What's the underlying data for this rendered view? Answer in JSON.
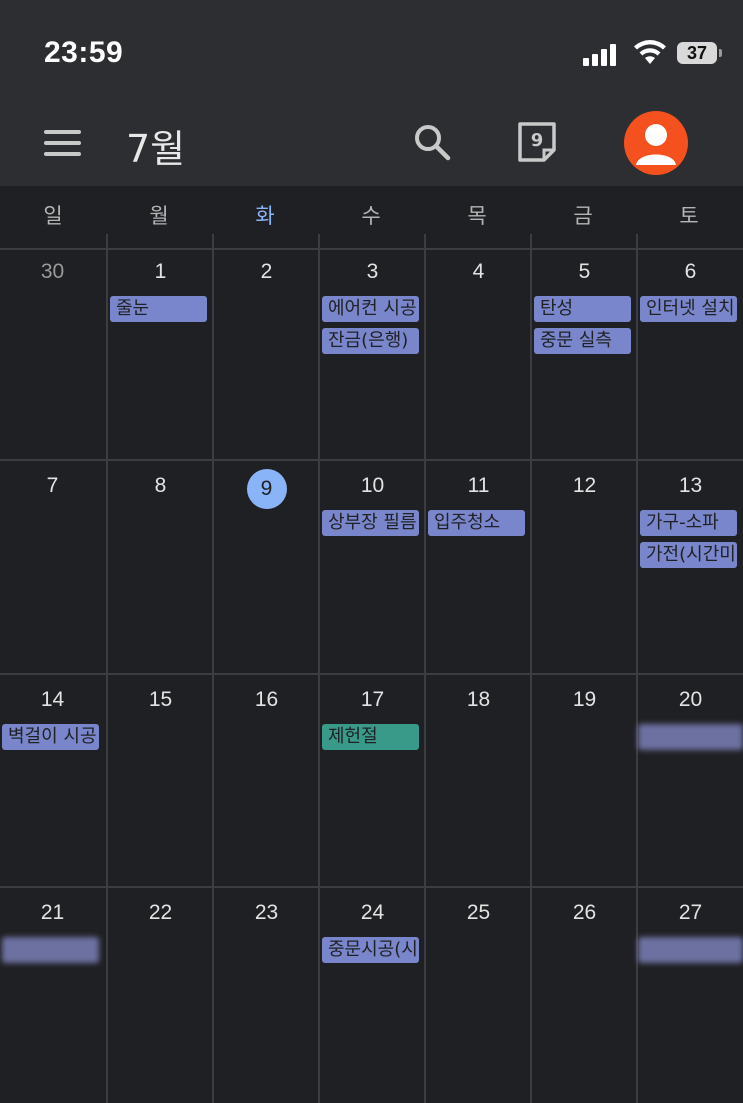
{
  "status_bar": {
    "time": "23:59",
    "battery_level": "37",
    "icons": [
      "cellular-signal-icon",
      "wifi-icon",
      "battery-icon"
    ]
  },
  "app_bar": {
    "month_title": "7월",
    "today_number": "9",
    "icons": [
      "menu-icon",
      "search-icon",
      "today-icon",
      "avatar-icon"
    ]
  },
  "weekdays": [
    "일",
    "월",
    "화",
    "수",
    "목",
    "금",
    "토"
  ],
  "colors": {
    "event": "#7986cb",
    "holiday": "#3a9a8a",
    "today_accent": "#8ab4f8",
    "avatar": "#f4511e"
  },
  "weeks": [
    [
      {
        "day": "30",
        "muted": true,
        "events": []
      },
      {
        "day": "1",
        "events": [
          {
            "title": "줄눈"
          }
        ]
      },
      {
        "day": "2",
        "events": []
      },
      {
        "day": "3",
        "events": [
          {
            "title": "에어컨 시공"
          },
          {
            "title": "잔금(은행)"
          }
        ]
      },
      {
        "day": "4",
        "events": []
      },
      {
        "day": "5",
        "events": [
          {
            "title": "탄성"
          },
          {
            "title": "중문 실측"
          }
        ]
      },
      {
        "day": "6",
        "events": [
          {
            "title": "인터넷 설치"
          }
        ]
      }
    ],
    [
      {
        "day": "7",
        "events": []
      },
      {
        "day": "8",
        "events": []
      },
      {
        "day": "9",
        "today": true,
        "events": []
      },
      {
        "day": "10",
        "events": [
          {
            "title": "상부장 필름"
          }
        ]
      },
      {
        "day": "11",
        "events": [
          {
            "title": "입주청소"
          }
        ]
      },
      {
        "day": "12",
        "events": []
      },
      {
        "day": "13",
        "events": [
          {
            "title": "가구-소파"
          },
          {
            "title": "가전(시간미"
          }
        ]
      }
    ],
    [
      {
        "day": "14",
        "events": [
          {
            "title": "벽걸이 시공"
          }
        ]
      },
      {
        "day": "15",
        "events": []
      },
      {
        "day": "16",
        "events": []
      },
      {
        "day": "17",
        "events": [
          {
            "title": "제헌절",
            "holiday": true
          }
        ]
      },
      {
        "day": "18",
        "events": []
      },
      {
        "day": "19",
        "events": []
      },
      {
        "day": "20",
        "events": [
          {
            "title": "",
            "blurred": true
          }
        ]
      }
    ],
    [
      {
        "day": "21",
        "events": [
          {
            "title": "",
            "blurred": true
          }
        ]
      },
      {
        "day": "22",
        "events": []
      },
      {
        "day": "23",
        "events": []
      },
      {
        "day": "24",
        "events": [
          {
            "title": "중문시공(시"
          }
        ]
      },
      {
        "day": "25",
        "events": []
      },
      {
        "day": "26",
        "events": []
      },
      {
        "day": "27",
        "events": [
          {
            "title": "",
            "blurred": true
          }
        ]
      }
    ]
  ]
}
